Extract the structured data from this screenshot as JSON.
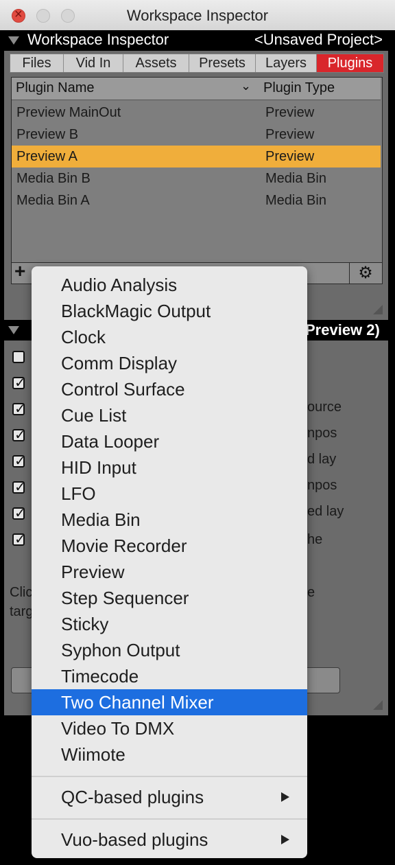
{
  "window": {
    "title": "Workspace Inspector"
  },
  "header": {
    "title": "Workspace Inspector",
    "project": "<Unsaved Project>"
  },
  "tabs": [
    {
      "label": "Files"
    },
    {
      "label": "Vid In"
    },
    {
      "label": "Assets"
    },
    {
      "label": "Presets"
    },
    {
      "label": "Layers"
    },
    {
      "label": "Plugins",
      "selected": true
    }
  ],
  "table": {
    "columns": {
      "name": "Plugin Name",
      "type": "Plugin Type"
    },
    "rows": [
      {
        "name": "Preview MainOut",
        "type": "Preview"
      },
      {
        "name": "Preview B",
        "type": "Preview"
      },
      {
        "name": "Preview A",
        "type": "Preview",
        "selected": true
      },
      {
        "name": "Media Bin B",
        "type": "Media Bin"
      },
      {
        "name": "Media Bin A",
        "type": "Media Bin"
      }
    ],
    "add_label": "+"
  },
  "lower": {
    "header_fragment": "Preview 2)",
    "fragments": [
      "ource",
      "npos",
      "d lay",
      "npos",
      "ed lay",
      "he",
      "Clic",
      "targ",
      "e"
    ]
  },
  "menu": {
    "items": [
      "Audio Analysis",
      "BlackMagic Output",
      "Clock",
      "Comm Display",
      "Control Surface",
      "Cue List",
      "Data Looper",
      "HID Input",
      "LFO",
      "Media Bin",
      "Movie Recorder",
      "Preview",
      "Step Sequencer",
      "Sticky",
      "Syphon Output",
      "Timecode",
      "Two Channel Mixer",
      "Video To DMX",
      "Wiimote"
    ],
    "highlighted": "Two Channel Mixer",
    "submenus": [
      "QC-based plugins",
      "Vuo-based plugins"
    ]
  },
  "colors": {
    "accent_tab": "#d9262b",
    "row_selected": "#f0ae3b",
    "menu_highlight": "#1d6ee0"
  }
}
